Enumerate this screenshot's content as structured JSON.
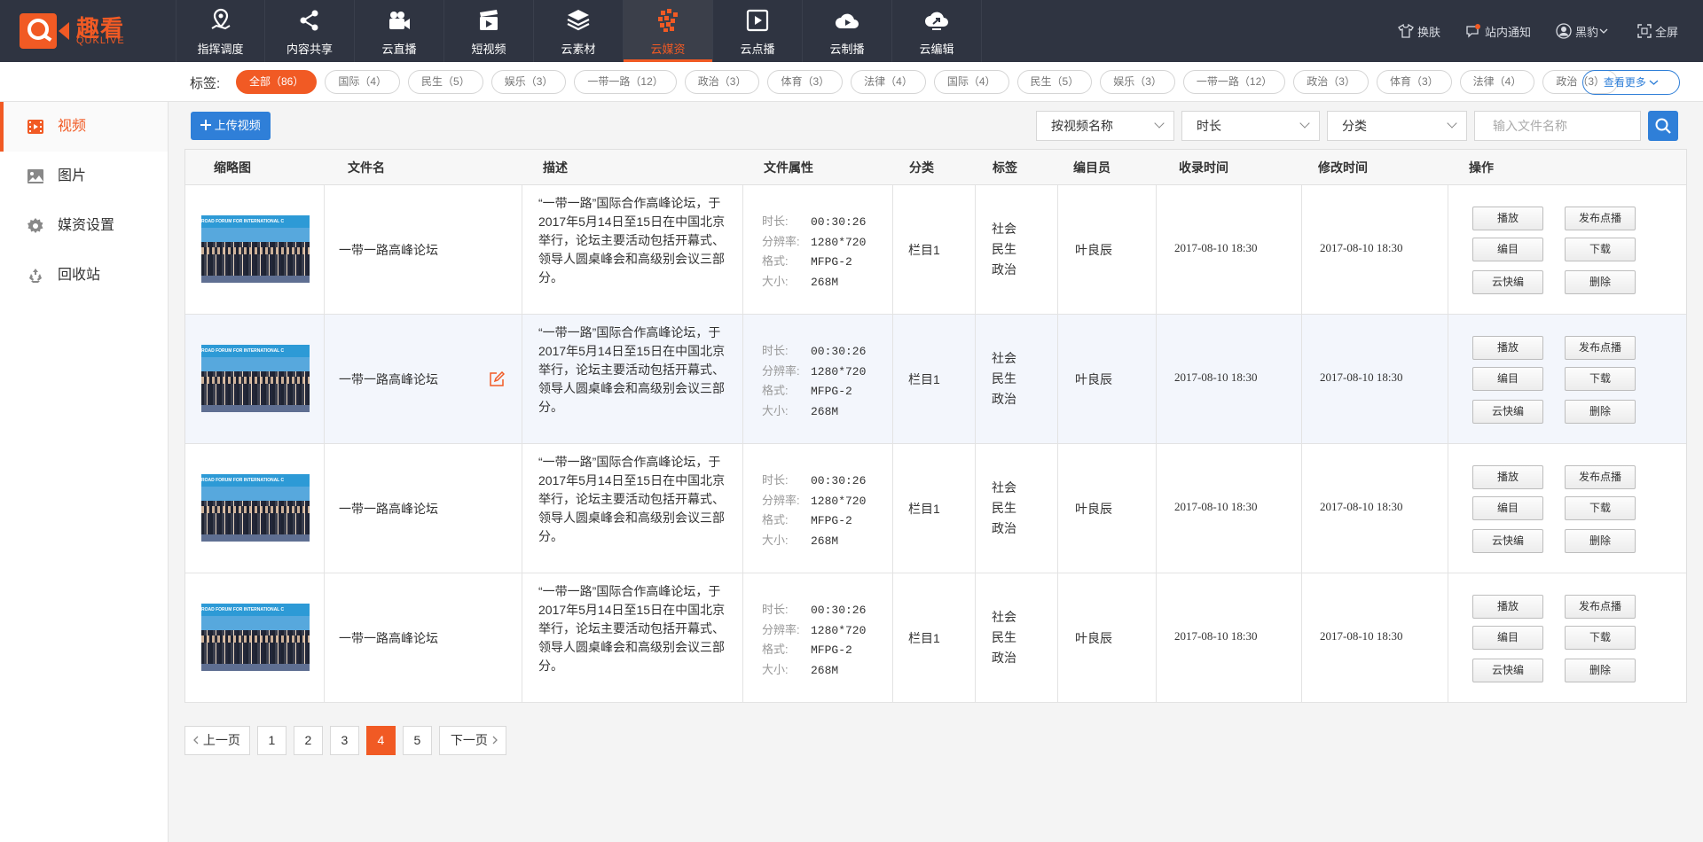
{
  "app": {
    "logo_text": "趣看",
    "logo_sub": "QUKLIVE"
  },
  "nav": [
    {
      "label": "指挥调度",
      "icon": "map-pin-icon"
    },
    {
      "label": "内容共享",
      "icon": "share-icon"
    },
    {
      "label": "云直播",
      "icon": "video-camera-icon"
    },
    {
      "label": "短视频",
      "icon": "clapperboard-icon"
    },
    {
      "label": "云素材",
      "icon": "layers-icon"
    },
    {
      "label": "云媒资",
      "icon": "media-grid-icon",
      "active": true
    },
    {
      "label": "云点播",
      "icon": "play-square-icon"
    },
    {
      "label": "云制播",
      "icon": "cloud-play-icon"
    },
    {
      "label": "云编辑",
      "icon": "cloud-edit-icon"
    }
  ],
  "top_right": {
    "skin": "换肤",
    "notify": "站内通知",
    "user": "黑豹",
    "fullscreen": "全屏"
  },
  "tagbar": {
    "label": "标签:",
    "tags": [
      "全部（86）",
      "国际（4）",
      "民生（5）",
      "娱乐（3）",
      "一带一路（12）",
      "政治（3）",
      "体育（3）",
      "法律（4）",
      "国际（4）",
      "民生（5）",
      "娱乐（3）",
      "一带一路（12）",
      "政治（3）",
      "体育（3）",
      "法律（4）",
      "政治（3）"
    ],
    "more": "查看更多"
  },
  "sidebar": {
    "items": [
      {
        "label": "视频",
        "icon": "film-icon",
        "active": true
      },
      {
        "label": "图片",
        "icon": "image-icon"
      },
      {
        "label": "媒资设置",
        "icon": "gear-icon"
      },
      {
        "label": "回收站",
        "icon": "recycle-icon"
      }
    ]
  },
  "toolbar": {
    "upload": "上传视频",
    "sort_select": "按视频名称",
    "duration_select": "时长",
    "category_select": "分类",
    "search_placeholder": "输入文件名称"
  },
  "table": {
    "headers": [
      "缩略图",
      "文件名",
      "描述",
      "文件属性",
      "分类",
      "标签",
      "编目员",
      "收录时间",
      "修改时间",
      "操作"
    ],
    "attr_keys": {
      "duration": "时长:",
      "resolution": "分辨率:",
      "format": "格式:",
      "size": "大小:"
    },
    "thumb_banner": "ROAD FORUM FOR INTERNATIONAL C",
    "ops": [
      "播放",
      "发布点播",
      "编目",
      "下载",
      "云快编",
      "删除"
    ],
    "rows": [
      {
        "name": "一带一路高峰论坛",
        "desc": "“一带一路”国际合作高峰论坛，于2017年5月14日至15日在中国北京举行，论坛主要活动包括开幕式、领导人圆桌峰会和高级别会议三部分。",
        "duration": "00:30:26",
        "resolution": "1280*720",
        "format": "MFPG-2",
        "size": "268M",
        "category": "栏目1",
        "tags": [
          "社会",
          "民生",
          "政治"
        ],
        "editor": "叶良辰",
        "created": "2017-08-10 18:30",
        "modified": "2017-08-10 18:30"
      },
      {
        "name": "一带一路高峰论坛",
        "desc": "“一带一路”国际合作高峰论坛，于2017年5月14日至15日在中国北京举行，论坛主要活动包括开幕式、领导人圆桌峰会和高级别会议三部分。",
        "duration": "00:30:26",
        "resolution": "1280*720",
        "format": "MFPG-2",
        "size": "268M",
        "category": "栏目1",
        "tags": [
          "社会",
          "民生",
          "政治"
        ],
        "editor": "叶良辰",
        "created": "2017-08-10 18:30",
        "modified": "2017-08-10 18:30",
        "editing": true
      },
      {
        "name": "一带一路高峰论坛",
        "desc": "“一带一路”国际合作高峰论坛，于2017年5月14日至15日在中国北京举行，论坛主要活动包括开幕式、领导人圆桌峰会和高级别会议三部分。",
        "duration": "00:30:26",
        "resolution": "1280*720",
        "format": "MFPG-2",
        "size": "268M",
        "category": "栏目1",
        "tags": [
          "社会",
          "民生",
          "政治"
        ],
        "editor": "叶良辰",
        "created": "2017-08-10 18:30",
        "modified": "2017-08-10 18:30"
      },
      {
        "name": "一带一路高峰论坛",
        "desc": "“一带一路”国际合作高峰论坛，于2017年5月14日至15日在中国北京举行，论坛主要活动包括开幕式、领导人圆桌峰会和高级别会议三部分。",
        "duration": "00:30:26",
        "resolution": "1280*720",
        "format": "MFPG-2",
        "size": "268M",
        "category": "栏目1",
        "tags": [
          "社会",
          "民生",
          "政治"
        ],
        "editor": "叶良辰",
        "created": "2017-08-10 18:30",
        "modified": "2017-08-10 18:30"
      }
    ]
  },
  "pagination": {
    "prev": "上一页",
    "next": "下一页",
    "pages": [
      "1",
      "2",
      "3",
      "4",
      "5"
    ],
    "current": "4"
  },
  "colors": {
    "accent": "#f15a24",
    "primary": "#2f7fd8",
    "topbar": "#2f3441"
  }
}
